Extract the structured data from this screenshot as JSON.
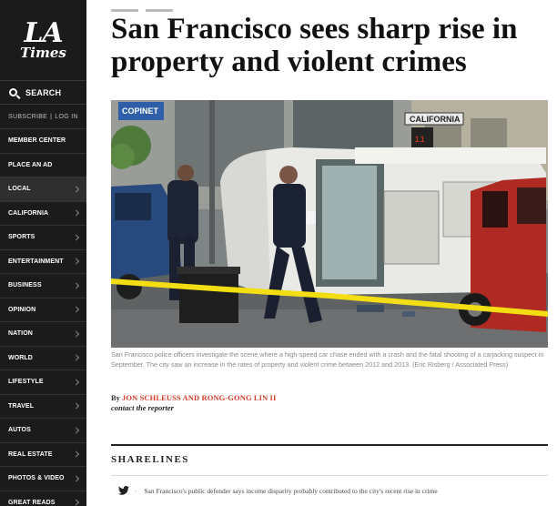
{
  "sidebar": {
    "logo_line1": "LA",
    "logo_line2": "Times",
    "search_label": "SEARCH",
    "subscribe_label": "SUBSCRIBE",
    "login_label": "LOG IN",
    "separator": "|",
    "items": [
      {
        "label": "MEMBER CENTER"
      },
      {
        "label": "PLACE AN AD"
      },
      {
        "label": "LOCAL"
      },
      {
        "label": "CALIFORNIA"
      },
      {
        "label": "SPORTS"
      },
      {
        "label": "ENTERTAINMENT"
      },
      {
        "label": "BUSINESS"
      },
      {
        "label": "OPINION"
      },
      {
        "label": "NATION"
      },
      {
        "label": "WORLD"
      },
      {
        "label": "LIFESTYLE"
      },
      {
        "label": "TRAVEL"
      },
      {
        "label": "AUTOS"
      },
      {
        "label": "REAL ESTATE"
      },
      {
        "label": "PHOTOS & VIDEO"
      },
      {
        "label": "GREAT READS"
      }
    ]
  },
  "article": {
    "headline": "San Francisco sees sharp rise in property and violent crimes",
    "photo": {
      "sign_left": "COPINET",
      "sign_street": "CALIFORNIA"
    },
    "caption": "San Francisco police officers investigate the scene where a high-speed car chase ended with a crash and the fatal shooting of a carjacking suspect in September. The city saw an increase in the rates of property and violent crime between 2012 and 2013. (Eric Risberg / Associated Press)",
    "byline_prefix": "By",
    "authors": "JON SCHLEUSS AND RONG-GONG LIN II",
    "contact": "contact the reporter"
  },
  "sharelines": {
    "title": "SHARELINES",
    "items": [
      {
        "dash": "-",
        "text": "San Francisco's public defender says income disparity probably contributed to the city's recent rise in crime"
      }
    ]
  },
  "colors": {
    "sidebar_bg": "#1b1b1b",
    "author_red": "#d13c2a",
    "tape_yellow": "#f2de12"
  }
}
